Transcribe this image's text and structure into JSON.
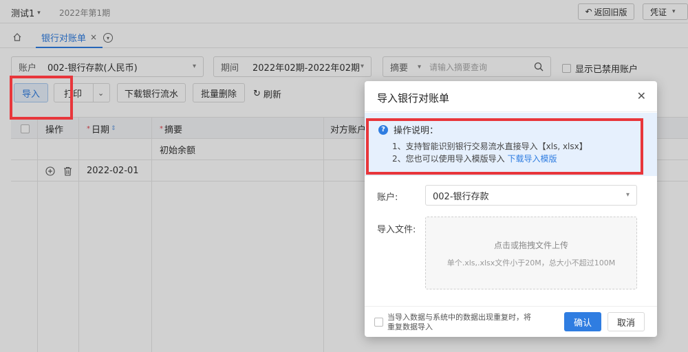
{
  "topbar": {
    "company": "测试1",
    "period": "2022年第1期",
    "return_button": "返回旧版",
    "voucher_select": "凭证"
  },
  "tabs": [
    {
      "label": "银行对账单",
      "close": "×"
    }
  ],
  "filters": {
    "account_label": "账户",
    "account_value": "002-银行存款(人民币)",
    "period_label": "期间",
    "period_value": "2022年02期-2022年02期",
    "summary_label": "摘要",
    "summary_placeholder": "请输入摘要查询",
    "show_disabled": "显示已禁用账户"
  },
  "toolbar": {
    "import": "导入",
    "print": "打印",
    "download": "下载银行流水",
    "batch_delete": "批量删除",
    "refresh": "刷新"
  },
  "table": {
    "headers": {
      "action": "操作",
      "date": "日期",
      "summary": "摘要",
      "counter_account": "对方账户"
    },
    "rows": [
      {
        "date": "",
        "summary": "初始余额"
      },
      {
        "date": "2022-02-01",
        "summary": ""
      }
    ]
  },
  "modal": {
    "title": "导入银行对账单",
    "info_title": "操作说明：",
    "info_line1": "1、支持智能识别银行交易流水直接导入【xls, xlsx】",
    "info_line2_prefix": "2、您也可以使用导入模版导入",
    "info_link": "下载导入模版",
    "account_label": "账户:",
    "account_value": "002-银行存款",
    "file_label": "导入文件:",
    "upload_main": "点击或拖拽文件上传",
    "upload_sub": "单个.xls,.xlsx文件小于20M，总大小不超过100M",
    "duplicate_line1": "当导入数据与系统中的数据出现重复时，将",
    "duplicate_line2": "重复数据导入",
    "confirm": "确认",
    "cancel": "取消"
  },
  "colors": {
    "accent": "#2f7de1",
    "highlight": "#e8363b",
    "info_bg": "#e6f0fd"
  }
}
